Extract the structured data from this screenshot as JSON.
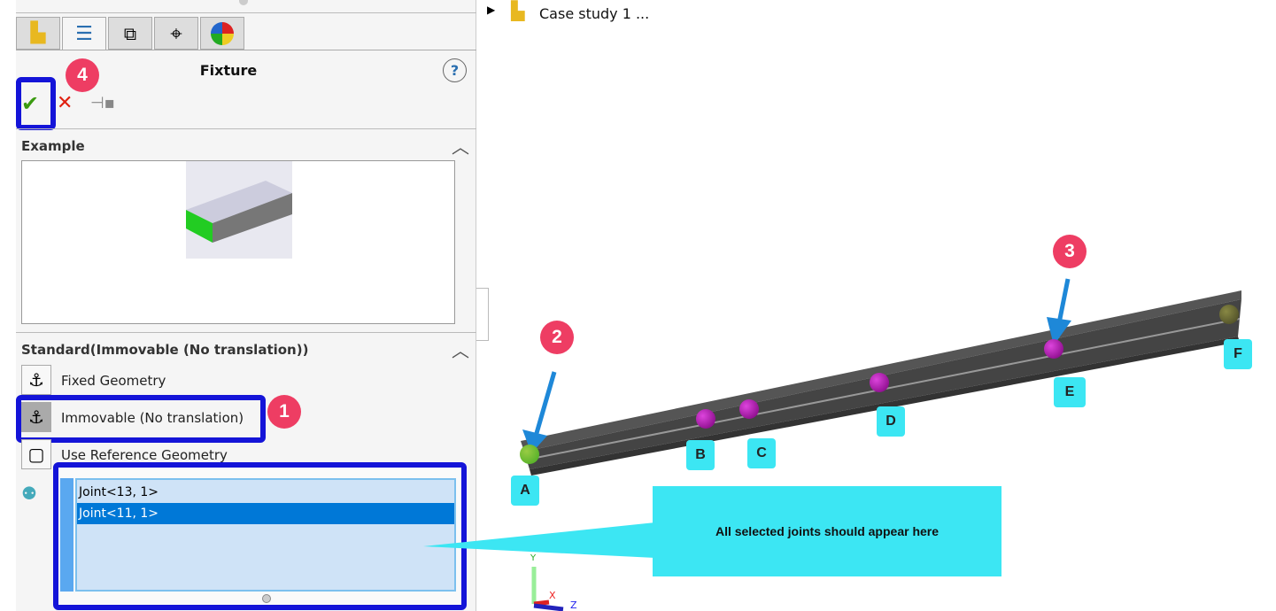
{
  "panel": {
    "tabs": [
      "part-icon",
      "property-manager-icon",
      "configuration-icon",
      "target-icon",
      "appearance-icon"
    ],
    "title": "Fixture",
    "ok": "✔",
    "cancel": "✕",
    "pin": "pin-icon",
    "help": "?",
    "example_header": "Example",
    "standard_header": "Standard(Immovable (No translation))",
    "options": [
      "Fixed Geometry",
      "Immovable (No translation)",
      "Use Reference Geometry"
    ],
    "selection": [
      "Joint<13, 1>",
      "Joint<11, 1>"
    ]
  },
  "tree": {
    "item": "Case study 1 ..."
  },
  "joints": [
    "A",
    "B",
    "C",
    "D",
    "E",
    "F"
  ],
  "steps": [
    "1",
    "2",
    "3",
    "4"
  ],
  "callout": "All selected joints should appear here",
  "axes": {
    "x": "X",
    "y": "Y",
    "z": "Z"
  },
  "colors": {
    "highlight": "#1414d8",
    "badge": "#ee3d63",
    "callout": "#3ce6f3",
    "selected": "#0078d7"
  }
}
